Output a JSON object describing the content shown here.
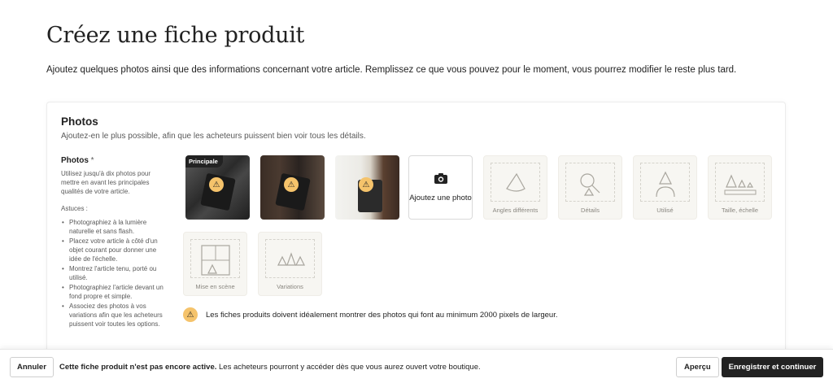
{
  "page": {
    "title": "Créez une fiche produit",
    "subtitle": "Ajoutez quelques photos ainsi que des informations concernant votre article. Remplissez ce que vous pouvez pour le moment, vous pourrez modifier le reste plus tard."
  },
  "photos_section": {
    "title": "Photos",
    "description": "Ajoutez-en le plus possible, afin que les acheteurs puissent bien voir tous les détails.",
    "sidebar": {
      "label": "Photos",
      "required_mark": "*",
      "hint": "Utilisez jusqu'à dix photos pour mettre en avant les principales qualités de votre article.",
      "tips_title": "Astuces :",
      "tips": [
        "Photographiez à la lumière naturelle et sans flash.",
        "Placez votre article à côté d'un objet courant pour donner une idée de l'échelle.",
        "Montrez l'article tenu, porté ou utilisé.",
        "Photographiez l'article devant un fond propre et simple.",
        "Associez des photos à vos variations afin que les acheteurs puissent voir toutes les options."
      ]
    },
    "main_badge": "Principale",
    "warning_icon": "⚠",
    "add_photo": {
      "icon": "camera-icon",
      "label": "Ajoutez une photo"
    },
    "placeholders": [
      {
        "label": "Angles différents"
      },
      {
        "label": "Détails"
      },
      {
        "label": "Utilisé"
      },
      {
        "label": "Taille, échelle"
      },
      {
        "label": "Mise en scène"
      },
      {
        "label": "Variations"
      }
    ],
    "notice": "Les fiches produits doivent idéalement montrer des photos qui font au minimum 2000 pixels de largeur."
  },
  "bottom_bar": {
    "cancel_label": "Annuler",
    "status_bold": "Cette fiche produit n'est pas encore active.",
    "status_text": " Les acheteurs pourront y accéder dès que vous aurez ouvert votre boutique.",
    "preview_label": "Aperçu",
    "save_label": "Enregistrer et continuer"
  },
  "colors": {
    "warning": "#f5c36b",
    "primary_button": "#222222",
    "placeholder_bg": "#f7f6f2"
  }
}
